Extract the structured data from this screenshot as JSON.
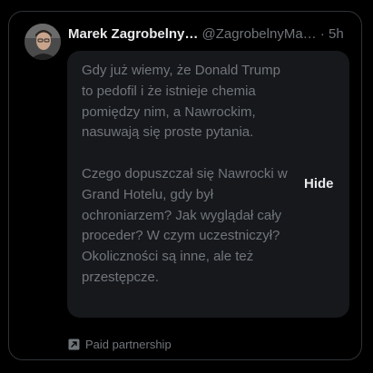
{
  "post": {
    "author_name": "Marek Zagrobelny…",
    "handle": "@ZagrobelnyMa…",
    "separator": "·",
    "time": "5h",
    "text": "Gdy już wiemy, że Donald Trump to pedofil i że istnieje chemia pomiędzy nim, a Nawrockim, nasuwają się proste pytania.\n\nCzego dopuszczał się Nawrocki w Grand Hotelu, gdy był ochroniarzem? Jak wyglądał cały proceder? W czym uczestniczył? Okoliczności są inne, ale też przestępcze.",
    "hide_label": "Hide",
    "footer_label": "Paid partnership"
  },
  "icons": {
    "paid": "arrow-up-right-square-icon"
  },
  "colors": {
    "background": "#000000",
    "border": "#2f3336",
    "bubble": "#16181c",
    "primary_text": "#e7e9ea",
    "secondary_text": "#71767b"
  }
}
